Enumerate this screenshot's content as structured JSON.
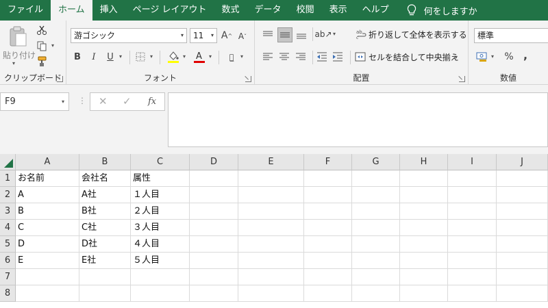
{
  "menu": {
    "tabs": [
      "ファイル",
      "ホーム",
      "挿入",
      "ページ レイアウト",
      "数式",
      "データ",
      "校閲",
      "表示",
      "ヘルプ"
    ],
    "active_tab": "ホーム",
    "tell_me": "何をしますか"
  },
  "ribbon": {
    "clipboard": {
      "label": "クリップボード",
      "paste_label": "貼り付け"
    },
    "font": {
      "label": "フォント",
      "font_name": "游ゴシック",
      "font_size": "11",
      "bold": "B",
      "italic": "I",
      "underline": "U"
    },
    "alignment": {
      "label": "配置",
      "wrap_text": "折り返して全体を表示する",
      "merge_center": "セルを結合して中央揃え"
    },
    "number": {
      "label": "数値",
      "format": "標準",
      "percent": "%",
      "comma": ","
    }
  },
  "formula_bar": {
    "name_box": "F9",
    "cancel": "✕",
    "enter": "✓",
    "fx": "fx",
    "formula": ""
  },
  "sheet": {
    "columns": [
      "A",
      "B",
      "C",
      "D",
      "E",
      "F",
      "G",
      "H",
      "I",
      "J"
    ],
    "rows": [
      "1",
      "2",
      "3",
      "4",
      "5",
      "6",
      "7",
      "8"
    ],
    "cells": [
      [
        "お名前",
        "会社名",
        "属性"
      ],
      [
        "A",
        "A社",
        "１人目"
      ],
      [
        "B",
        "B社",
        "２人目"
      ],
      [
        "C",
        "C社",
        "３人目"
      ],
      [
        "D",
        "D社",
        "４人目"
      ],
      [
        "E",
        "E社",
        "５人目"
      ],
      [
        "",
        "",
        ""
      ],
      [
        "",
        "",
        ""
      ]
    ]
  },
  "colors": {
    "brand": "#217346",
    "font_color_bar": "#e00000",
    "fill_color_bar": "#ffff00"
  }
}
